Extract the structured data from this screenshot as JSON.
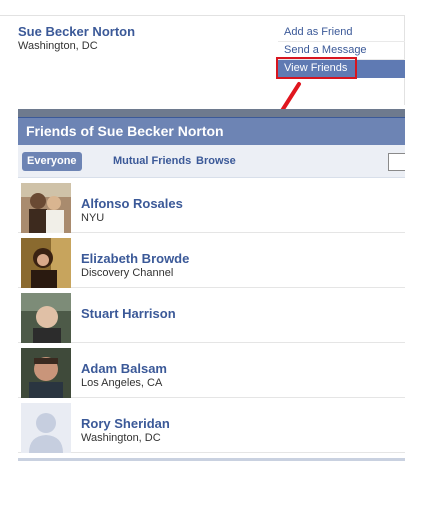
{
  "profile": {
    "name": "Sue Becker Norton",
    "location": "Washington, DC"
  },
  "actions": [
    {
      "label": "Add as Friend",
      "selected": false
    },
    {
      "label": "Send a Message",
      "selected": false
    },
    {
      "label": "View Friends",
      "selected": true
    }
  ],
  "annotation": {
    "color": "#d8151f"
  },
  "friends_panel": {
    "title": "Friends of Sue Becker Norton",
    "tabs": [
      {
        "label": "Everyone",
        "active": true
      },
      {
        "label": "Mutual Friends",
        "active": false
      },
      {
        "label": "Browse",
        "active": false
      }
    ]
  },
  "friends": [
    {
      "name": "Alfonso Rosales",
      "network": "NYU"
    },
    {
      "name": "Elizabeth Browde",
      "network": "Discovery Channel"
    },
    {
      "name": "Stuart Harrison",
      "network": ""
    },
    {
      "name": "Adam Balsam",
      "network": "Los Angeles, CA"
    },
    {
      "name": "Rory Sheridan",
      "network": "Washington, DC"
    }
  ],
  "colors": {
    "link": "#3b5998",
    "header_bg": "#6d84b4",
    "filter_bg": "#eceff5"
  }
}
